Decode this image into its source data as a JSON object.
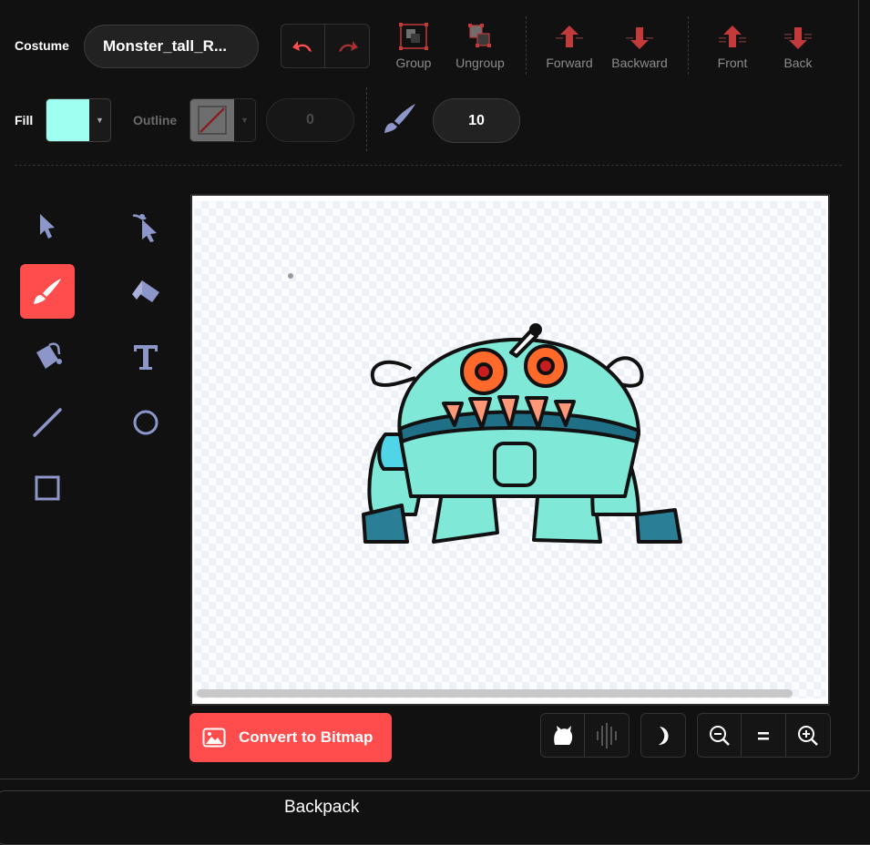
{
  "toolbar": {
    "costume_label": "Costume",
    "costume_name": "Monster_tall_R...",
    "undo_icon": "undo-icon",
    "redo_icon": "redo-icon",
    "group_label": "Group",
    "ungroup_label": "Ungroup",
    "forward_label": "Forward",
    "backward_label": "Backward",
    "front_label": "Front",
    "back_label": "Back"
  },
  "style": {
    "fill_label": "Fill",
    "fill_color": "#9ffff0",
    "outline_label": "Outline",
    "outline_width": "0",
    "brush_size": "10"
  },
  "tools": [
    "select",
    "reshape",
    "brush",
    "eraser",
    "fill",
    "text",
    "line",
    "circle",
    "rectangle"
  ],
  "active_tool": "brush",
  "colors": {
    "accent": "#ff4c4c",
    "arrow_red": "#c23a3a",
    "tool_icon": "#8c96c8",
    "monster_body": "#7fe8d6",
    "monster_arm": "#4fd4e8",
    "monster_eye": "#ff6a2a"
  },
  "footer": {
    "convert_label": "Convert to Bitmap",
    "backpack_label": "Backpack"
  }
}
